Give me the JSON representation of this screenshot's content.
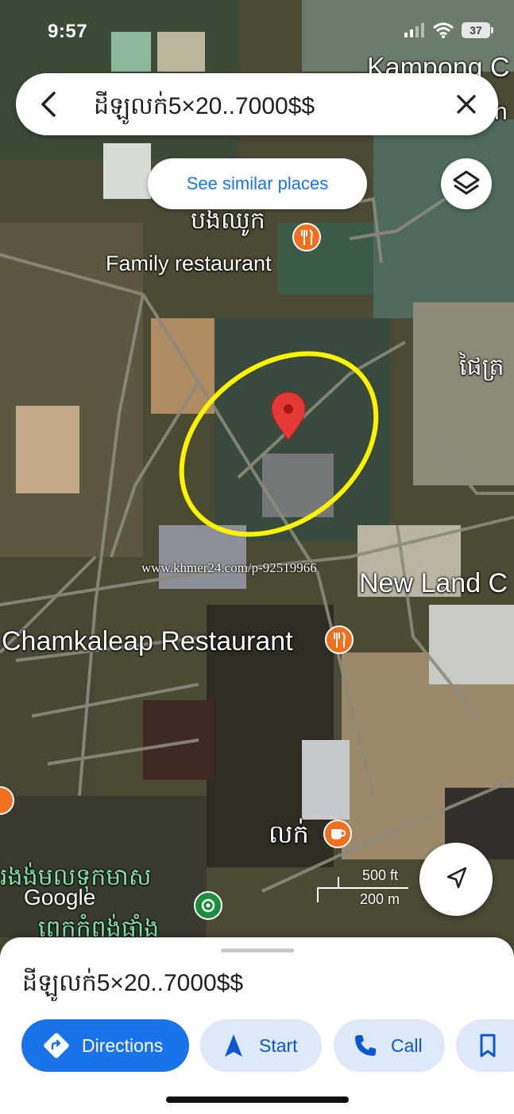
{
  "status_bar": {
    "time": "9:57",
    "battery": "37"
  },
  "search": {
    "query": "ដីឡូលក់5×20..7000$$"
  },
  "buttons": {
    "see_similar": "See similar places"
  },
  "map_labels": {
    "top_right_place": "Kampong C",
    "top_right_place_2": "n",
    "khmer_restaurant": "បងឈូក",
    "family_restaurant": "Family restaurant",
    "right_edge_khmer": "ផៃត្រ",
    "new_land": "New Land C",
    "chamkaleap": "Chamkaleap Restaurant",
    "cafe_khmer": "លក់",
    "bottom_khmer_1": "រងង់មលទុកមាស",
    "bottom_khmer_2": "ពេកកំពង់ផាំង",
    "watermark": "www.khmer24.com/p-92519966",
    "google": "Google"
  },
  "scale": {
    "ft": "500 ft",
    "m": "200 m"
  },
  "sheet": {
    "title": "ដីឡូលក់5×20..7000$$",
    "actions": {
      "directions": "Directions",
      "start": "Start",
      "call": "Call"
    }
  },
  "colors": {
    "accent": "#1a73e8",
    "pin": "#e53935",
    "poi": "#f07020",
    "highlight": "#fff200"
  }
}
